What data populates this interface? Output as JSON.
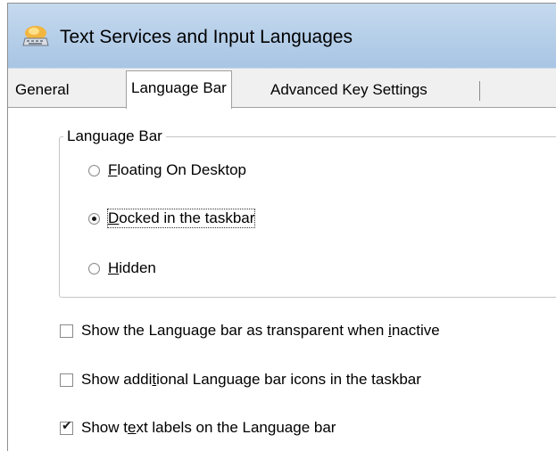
{
  "window": {
    "title": "Text Services and Input Languages",
    "title_icon": "keyboard-globe-icon"
  },
  "tabs": [
    {
      "label": "General",
      "selected": false
    },
    {
      "label": "Language Bar",
      "selected": true
    },
    {
      "label": "Advanced Key Settings",
      "selected": false
    }
  ],
  "language_bar_group": {
    "legend": "Language Bar",
    "options": [
      {
        "pre": "",
        "accel": "F",
        "post": "loating On Desktop",
        "selected": false
      },
      {
        "pre": "",
        "accel": "D",
        "post": "ocked in the taskbar",
        "selected": true
      },
      {
        "pre": "",
        "accel": "H",
        "post": "idden",
        "selected": false
      }
    ]
  },
  "checkboxes": [
    {
      "pre": "Show the Language bar as transparent when ",
      "accel": "i",
      "post": "nactive",
      "checked": false
    },
    {
      "pre": "Show addi",
      "accel": "t",
      "post": "ional Language bar icons in the taskbar",
      "checked": false
    },
    {
      "pre": "Show t",
      "accel": "e",
      "post": "xt labels on the Language bar",
      "checked": true
    }
  ]
}
